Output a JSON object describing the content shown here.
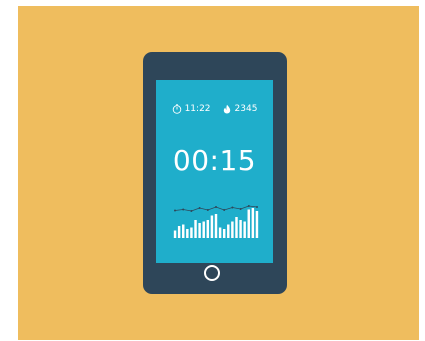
{
  "status": {
    "time": "11:22",
    "calories": "2345",
    "time_icon": "stopwatch-icon",
    "calories_icon": "flame-icon"
  },
  "timer": {
    "value": "00:15"
  },
  "colors": {
    "background": "#efbd5e",
    "phone_body": "#2e4659",
    "screen": "#1faecb",
    "foreground": "#ffffff"
  },
  "activity_chart": {
    "bars": [
      0.25,
      0.4,
      0.45,
      0.3,
      0.35,
      0.6,
      0.5,
      0.55,
      0.6,
      0.75,
      0.8,
      0.35,
      0.3,
      0.45,
      0.55,
      0.7,
      0.6,
      0.55,
      0.95,
      1.0,
      0.9
    ],
    "trend": [
      0.55,
      0.65,
      0.5,
      0.8,
      0.6,
      0.9,
      0.6,
      0.85,
      0.7,
      1.0,
      0.9
    ]
  }
}
